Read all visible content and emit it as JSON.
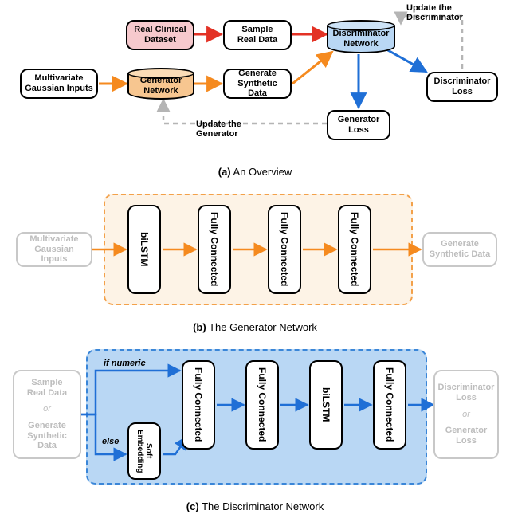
{
  "panel_a": {
    "caption_label": "(a)",
    "caption_text": "An Overview",
    "boxes": {
      "real_clinical_dataset": "Real Clinical\nDataset",
      "sample_real_data": "Sample\nReal Data",
      "discriminator_network": "Discriminator\nNetwork",
      "multivariate_gaussian_inputs": "Multivariate\nGaussian Inputs",
      "generator_network": "Generator\nNetwork",
      "generate_synthetic_data": "Generate\nSynthetic Data",
      "discriminator_loss": "Discriminator\nLoss",
      "generator_loss": "Generator\nLoss"
    },
    "annotations": {
      "update_discriminator": "Update the\nDiscriminator",
      "update_generator": "Update the\nGenerator"
    },
    "colors": {
      "pink": "#f6c9cd",
      "orange": "#f7c690",
      "blue": "#b9d7f4",
      "arrow_red": "#e33225",
      "arrow_orange": "#f58a1f",
      "arrow_blue": "#1f6fd6",
      "arrow_gray": "#b5b5b5"
    }
  },
  "panel_b": {
    "caption_label": "(b)",
    "caption_text": "The Generator Network",
    "input": "Multivariate\nGaussian Inputs",
    "layers": [
      "biLSTM",
      "Fully Connected",
      "Fully Connected",
      "Fully Connected"
    ],
    "output": "Generate\nSynthetic Data",
    "region_bg": "#fdf3e6",
    "region_border": "#f3a14a",
    "arrow_color": "#f58a1f"
  },
  "panel_c": {
    "caption_label": "(c)",
    "caption_text": "The Discriminator Network",
    "input_top": "Sample\nReal Data",
    "input_or": "or",
    "input_bottom": "Generate\nSynthetic Data",
    "branch_if": "if numeric",
    "branch_else": "else",
    "soft_embedding": "Soft Embedding",
    "layers": [
      "Fully Connected",
      "Fully Connected",
      "biLSTM",
      "Fully Connected"
    ],
    "output_top": "Discriminator\nLoss",
    "output_or": "or",
    "output_bottom": "Generator\nLoss",
    "region_bg": "#b9d7f4",
    "region_border": "#3a86d8",
    "arrow_color": "#1f6fd6"
  }
}
